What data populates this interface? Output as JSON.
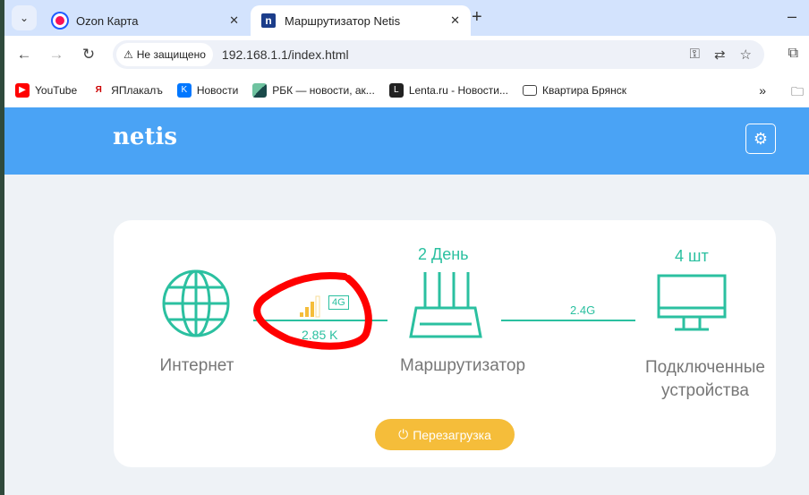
{
  "browser": {
    "tabs": [
      {
        "title": "Ozon Карта",
        "active": false
      },
      {
        "title": "Маршрутизатор Netis",
        "active": true
      }
    ],
    "security_label": "Не защищено",
    "url": "192.168.1.1/index.html",
    "bookmarks": [
      {
        "label": "YouTube",
        "icon": "youtube-icon"
      },
      {
        "label": "ЯПлакалъ",
        "icon": "yaplakal-icon"
      },
      {
        "label": "Новости",
        "icon": "vk-icon"
      },
      {
        "label": "РБК — новости, ак...",
        "icon": "rbc-icon"
      },
      {
        "label": "Lenta.ru - Новости...",
        "icon": "lenta-icon"
      },
      {
        "label": "Квартира Брянск",
        "icon": "folder-icon"
      }
    ]
  },
  "header": {
    "logo": "netis"
  },
  "status": {
    "internet_label": "Интернет",
    "network_type": "4G",
    "signal_bars": 3,
    "signal_max": 4,
    "speed": "2.85 K",
    "uptime": "2 День",
    "router_label": "Маршрутизатор",
    "wifi_band": "2.4G",
    "devices_count": "4 шт",
    "devices_label": "Подключенные устройства",
    "reboot_label": "Перезагрузка"
  },
  "colors": {
    "header": "#4aa3f5",
    "accent": "#2bc0a0",
    "signal": "#f5bd3a",
    "reboot": "#f5bd3a",
    "annotation": "#ff0000"
  }
}
